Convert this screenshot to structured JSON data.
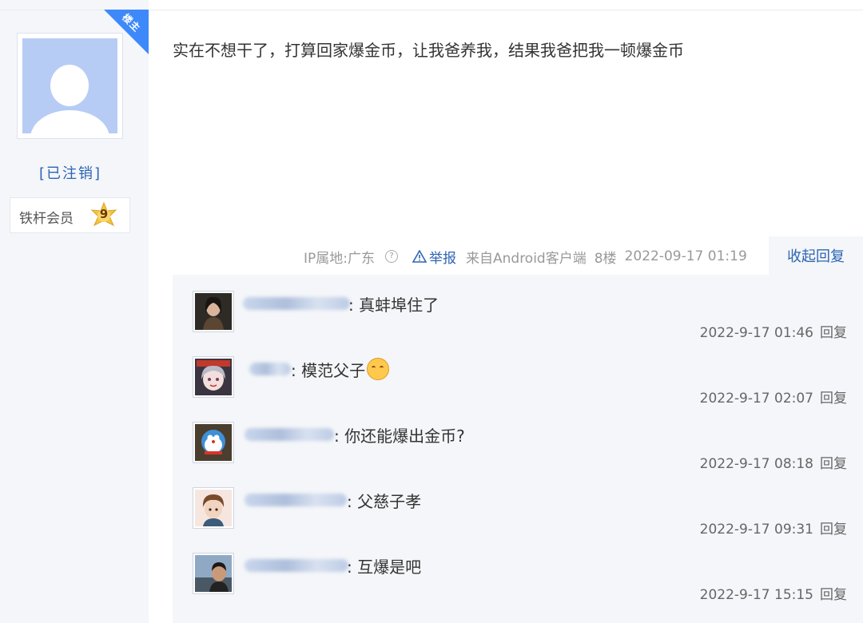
{
  "author": {
    "badge": "楼主",
    "name": "[已注销]",
    "member_label": "铁杆会员",
    "level": "9"
  },
  "post": {
    "content": "实在不想干了，打算回家爆金币，让我爸养我，结果我爸把我一顿爆金币",
    "ip_location": "IP属地:广东",
    "report": "举报",
    "client": "来自Android客户端",
    "floor": "8楼",
    "time": "2022-09-17 01:19",
    "collapse": "收起回复"
  },
  "replies": [
    {
      "text": ": 真蚌埠住了",
      "time": "2022-9-17 01:46",
      "reply_label": "回复"
    },
    {
      "text": ": 模范父子",
      "time": "2022-9-17 02:07",
      "reply_label": "回复"
    },
    {
      "text": ": 你还能爆出金币?",
      "time": "2022-9-17 08:18",
      "reply_label": "回复"
    },
    {
      "text": ": 父慈子孝",
      "time": "2022-9-17 09:31",
      "reply_label": "回复"
    },
    {
      "text": ": 互爆是吧",
      "time": "2022-9-17 15:15",
      "reply_label": "回复"
    }
  ],
  "colors": {
    "link_blue": "#2d64b3",
    "badge_blue": "#3e89fa",
    "panel_bg": "#f4f6f9"
  }
}
